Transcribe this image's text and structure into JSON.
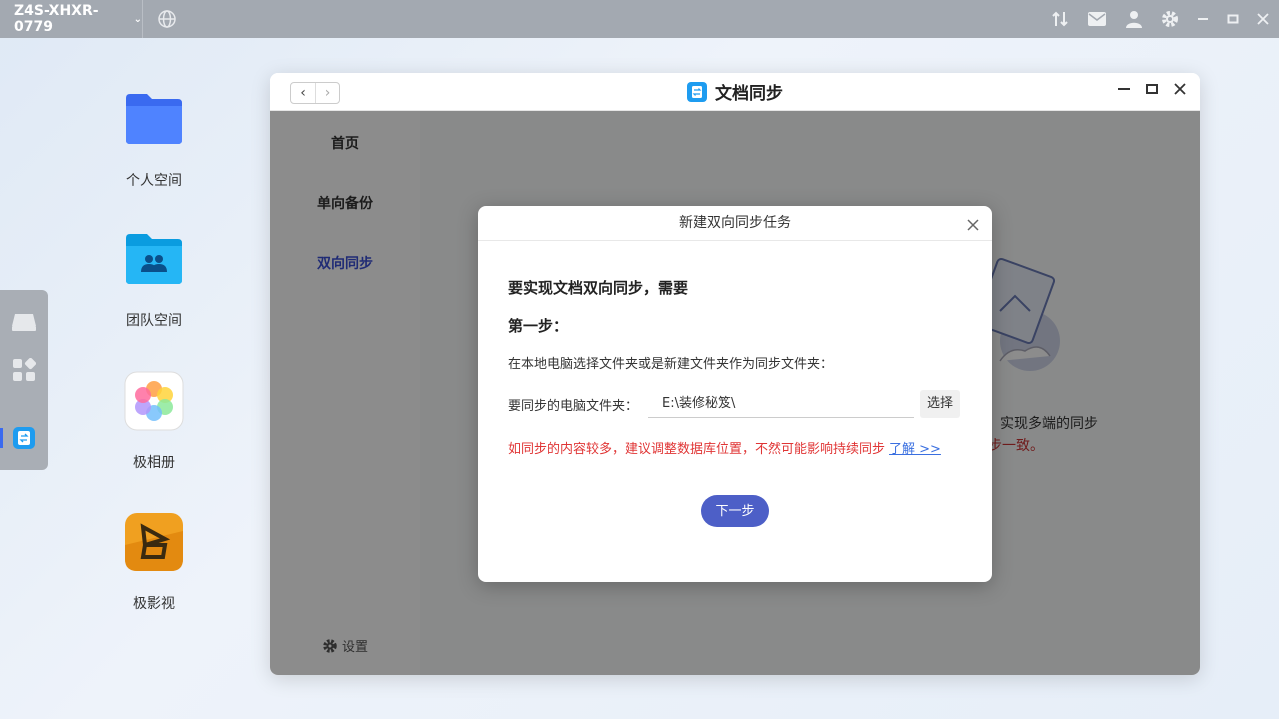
{
  "topbar": {
    "device_name": "Z4S-XHXR-0779",
    "chevron": "⌄"
  },
  "desktop": {
    "icons": [
      {
        "label": "个人空间"
      },
      {
        "label": "团队空间"
      },
      {
        "label": "极相册"
      },
      {
        "label": "极影视"
      }
    ]
  },
  "window": {
    "title": "文档同步",
    "back": "‹",
    "forward": "›",
    "sidebar": {
      "items": [
        {
          "label": "首页"
        },
        {
          "label": "单向备份"
        },
        {
          "label": "双向同步"
        }
      ],
      "settings": "设置"
    },
    "background_text": {
      "line1": "实现多端的同步",
      "line2": "步一致。"
    }
  },
  "dialog": {
    "title": "新建双向同步任务",
    "heading": "要实现文档双向同步，需要",
    "step": "第一步：",
    "description": "在本地电脑选择文件夹或是新建文件夹作为同步文件夹：",
    "folder_label": "要同步的电脑文件夹：",
    "folder_value": "E:\\装修秘笈\\",
    "choose_button": "选择",
    "warning": "如同步的内容较多，建议调整数据库位置，不然可能影响持续同步",
    "learn_more": "了解 >>",
    "next_button": "下一步"
  },
  "colors": {
    "accent": "#4d5fc7",
    "warning": "#e03535",
    "active_nav": "#3a4fd6"
  }
}
